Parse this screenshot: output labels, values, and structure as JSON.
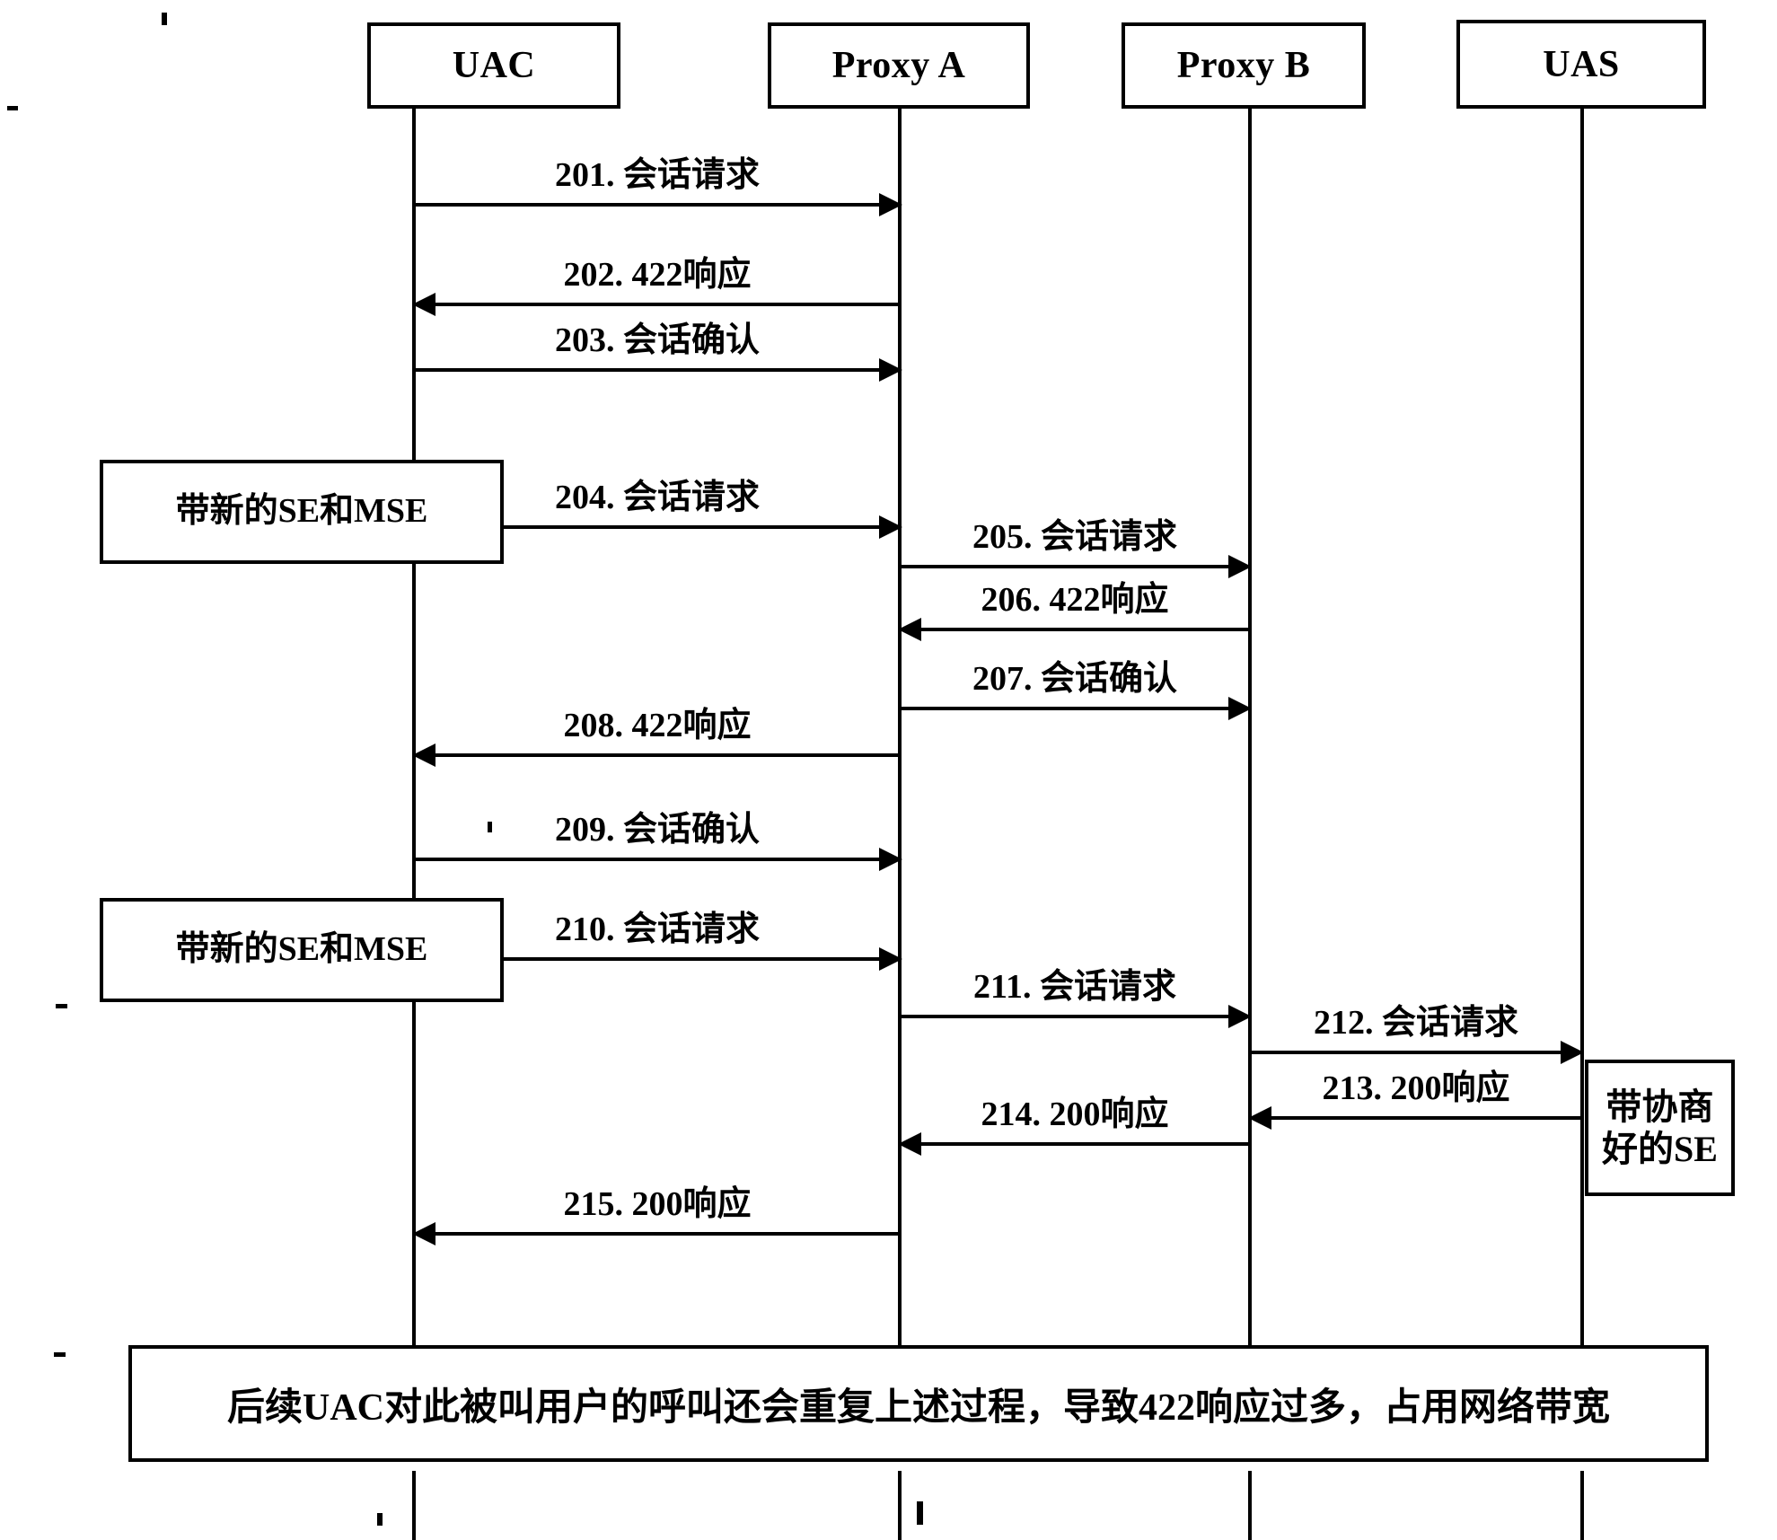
{
  "diagram": {
    "title": "SIP session-timer call flow with 422 responses",
    "actors": [
      {
        "id": "uac",
        "label": "UAC"
      },
      {
        "id": "proxy_a",
        "label": "Proxy A"
      },
      {
        "id": "proxy_b",
        "label": "Proxy B"
      },
      {
        "id": "uas",
        "label": "UAS"
      }
    ],
    "messages": [
      {
        "n": "201",
        "label": "201. 会话请求",
        "from": "uac",
        "to": "proxy_a",
        "dir": "right"
      },
      {
        "n": "202",
        "label": "202. 422响应",
        "from": "proxy_a",
        "to": "uac",
        "dir": "left"
      },
      {
        "n": "203",
        "label": "203. 会话确认",
        "from": "uac",
        "to": "proxy_a",
        "dir": "right"
      },
      {
        "n": "204",
        "label": "204. 会话请求",
        "from": "uac",
        "to": "proxy_a",
        "dir": "right"
      },
      {
        "n": "205",
        "label": "205. 会话请求",
        "from": "proxy_a",
        "to": "proxy_b",
        "dir": "right"
      },
      {
        "n": "206",
        "label": "206. 422响应",
        "from": "proxy_b",
        "to": "proxy_a",
        "dir": "left"
      },
      {
        "n": "207",
        "label": "207. 会话确认",
        "from": "proxy_a",
        "to": "proxy_b",
        "dir": "right"
      },
      {
        "n": "208",
        "label": "208. 422响应",
        "from": "proxy_a",
        "to": "uac",
        "dir": "left"
      },
      {
        "n": "209",
        "label": "209. 会话确认",
        "from": "uac",
        "to": "proxy_a",
        "dir": "right"
      },
      {
        "n": "210",
        "label": "210. 会话请求",
        "from": "uac",
        "to": "proxy_a",
        "dir": "right"
      },
      {
        "n": "211",
        "label": "211. 会话请求",
        "from": "proxy_a",
        "to": "proxy_b",
        "dir": "right"
      },
      {
        "n": "212",
        "label": "212. 会话请求",
        "from": "proxy_b",
        "to": "uas",
        "dir": "right"
      },
      {
        "n": "213",
        "label": "213. 200响应",
        "from": "uas",
        "to": "proxy_b",
        "dir": "left"
      },
      {
        "n": "214",
        "label": "214. 200响应",
        "from": "proxy_b",
        "to": "proxy_a",
        "dir": "left"
      },
      {
        "n": "215",
        "label": "215. 200响应",
        "from": "proxy_a",
        "to": "uac",
        "dir": "left"
      }
    ],
    "notes": [
      {
        "id": "note_se_mse_1",
        "text": "带新的SE和MSE"
      },
      {
        "id": "note_se_mse_2",
        "text": "带新的SE和MSE"
      },
      {
        "id": "note_negotiated_se",
        "text": "带协商\n好的SE"
      }
    ],
    "summary": {
      "text": "后续UAC对此被叫用户的呼叫还会重复上述过程，导致422响应过多，占用网络带宽"
    },
    "colors": {
      "stroke": "#000000",
      "background": "#ffffff"
    }
  }
}
